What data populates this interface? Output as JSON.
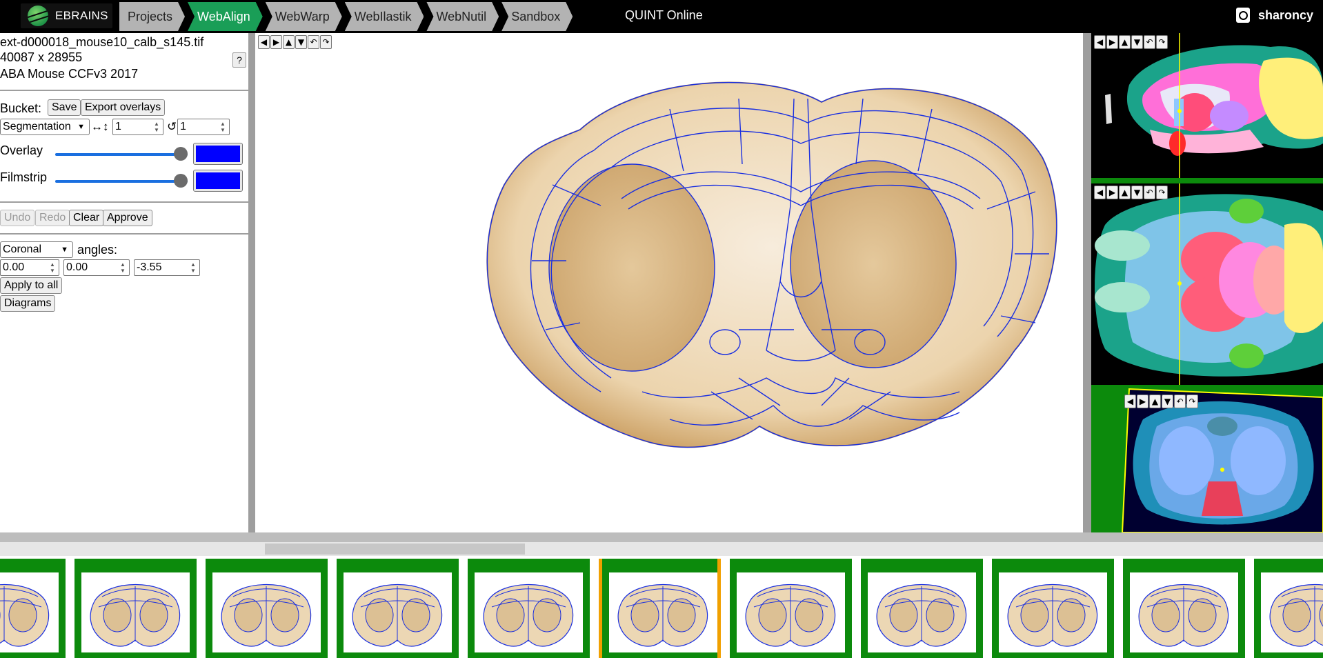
{
  "brand": {
    "name": "EBRAINS"
  },
  "tabs": [
    {
      "label": "Projects",
      "active": false
    },
    {
      "label": "WebAlign",
      "active": true
    },
    {
      "label": "WebWarp",
      "active": false
    },
    {
      "label": "WebIlastik",
      "active": false
    },
    {
      "label": "WebNutil",
      "active": false
    },
    {
      "label": "Sandbox",
      "active": false
    }
  ],
  "app_title": "QUINT Online",
  "user": {
    "name": "sharoncy"
  },
  "image_info": {
    "filename": "ext-d000018_mouse10_calb_s145.tif",
    "dimensions": "40087 x 28955",
    "atlas": "ABA Mouse CCFv3 2017",
    "help_label": "?"
  },
  "bucket": {
    "label": "Bucket:",
    "save_label": "Save",
    "export_label": "Export overlays"
  },
  "segmentation": {
    "mode": "Segmentation",
    "resize_icon": "↔↕",
    "size_value": "1",
    "rotate_icon": "↺",
    "rotate_value": "1"
  },
  "overlay": {
    "label": "Overlay",
    "level": 1.0,
    "color": "#0000ff"
  },
  "filmstrip_opt": {
    "label": "Filmstrip",
    "level": 1.0,
    "color": "#0000ff"
  },
  "actions": {
    "undo": "Undo",
    "redo": "Redo",
    "clear": "Clear",
    "approve": "Approve"
  },
  "orientation": {
    "plane": "Coronal",
    "angles_label": "angles:",
    "angle1": "0.00",
    "angle2": "0.00",
    "angle3": "-3.55",
    "apply_label": "Apply to all",
    "diagrams_label": "Diagrams"
  },
  "nav_icons": [
    "◀",
    "▶",
    "▲",
    "▼",
    "↶",
    "↷"
  ],
  "colors": {
    "accent": "#1a9e57",
    "overlay": "#0000ff",
    "tissue": "#d9b98a",
    "filmstrip_frame": "#0c8a0c",
    "selected_frame": "#f0a000",
    "crosshair": "#ffff00"
  },
  "filmstrip": {
    "count": 11,
    "selected_index": 5
  }
}
